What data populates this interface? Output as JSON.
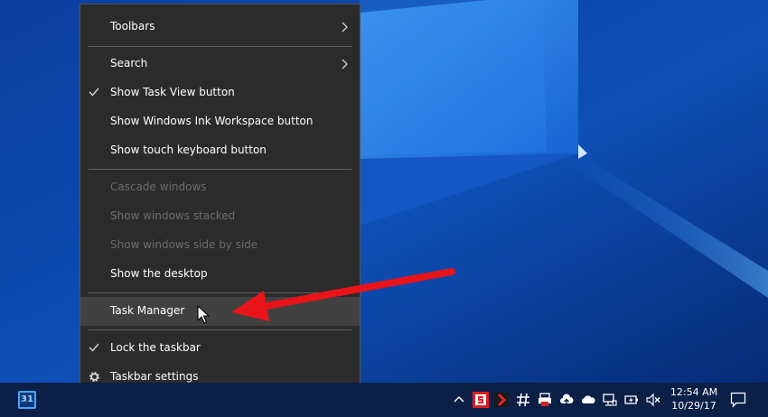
{
  "context_menu": {
    "items": [
      {
        "label": "Toolbars",
        "submenu": true
      },
      {
        "label": "Search",
        "submenu": true
      },
      {
        "label": "Show Task View button",
        "checked": true
      },
      {
        "label": "Show Windows Ink Workspace button"
      },
      {
        "label": "Show touch keyboard button"
      },
      {
        "label": "Cascade windows",
        "disabled": true
      },
      {
        "label": "Show windows stacked",
        "disabled": true
      },
      {
        "label": "Show windows side by side",
        "disabled": true
      },
      {
        "label": "Show the desktop"
      },
      {
        "label": "Task Manager",
        "highlighted": true
      },
      {
        "label": "Lock the taskbar",
        "checked": true
      },
      {
        "label": "Taskbar settings",
        "icon": "gear-icon"
      }
    ]
  },
  "taskbar": {
    "pinned_app_badge": "31",
    "tray_icons": [
      "chevron-up-icon",
      "s-app-icon",
      "red-chevron-icon",
      "hash-icon",
      "printer-lock-icon",
      "cloud-upload-icon",
      "onedrive-icon",
      "network-icon",
      "battery-icon",
      "volume-muted-icon"
    ],
    "clock": {
      "time": "12:54 AM",
      "date": "10/29/17"
    },
    "notification_icon": "action-center-icon"
  },
  "colors": {
    "menu_bg": "#2b2b2b",
    "menu_highlight": "#414141",
    "taskbar_bg": "#0b1f47",
    "annotation_arrow": "#e8141a"
  }
}
